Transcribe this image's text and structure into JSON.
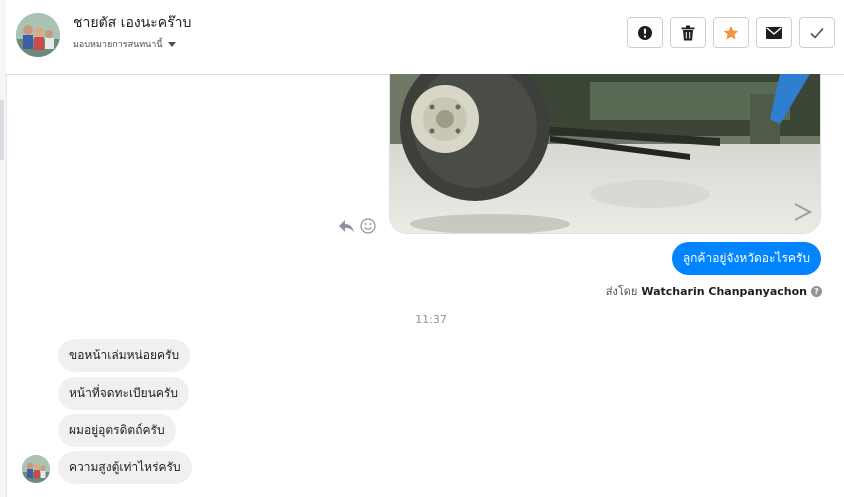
{
  "header": {
    "contact_name": "ชายตัส เองนะคร๊าบ",
    "assign_label": "มอบหมายการสนทนานี้",
    "avatar_icon": "profile-photo-icon",
    "toolbar": [
      {
        "name": "mark-spam-button",
        "icon": "exclamation-icon"
      },
      {
        "name": "delete-button",
        "icon": "trash-icon"
      },
      {
        "name": "star-button",
        "icon": "star-icon",
        "color": "#f7923b"
      },
      {
        "name": "mark-unread-button",
        "icon": "envelope-icon"
      },
      {
        "name": "mark-done-button",
        "icon": "check-icon"
      }
    ]
  },
  "thread": {
    "outgoing_message": "ลูกค้าอยู่จังหวัดอะไรครับ",
    "sent_by_prefix": "ส่งโดย",
    "sent_by_name": "Watcharin Chanpanyachon",
    "timestamp": "11:37",
    "incoming_messages": [
      "ขอหน้าเล่มหน่อยครับ",
      "หน้าที่จดทะเบียนครับ",
      "ผมอยู่อุตรดิตถ์ครับ",
      "ความสูงตู้เท่าไหร่ครับ"
    ]
  },
  "colors": {
    "outgoing_bubble": "#0084ff",
    "incoming_bubble": "#f1f0f0",
    "star": "#f7923b"
  }
}
